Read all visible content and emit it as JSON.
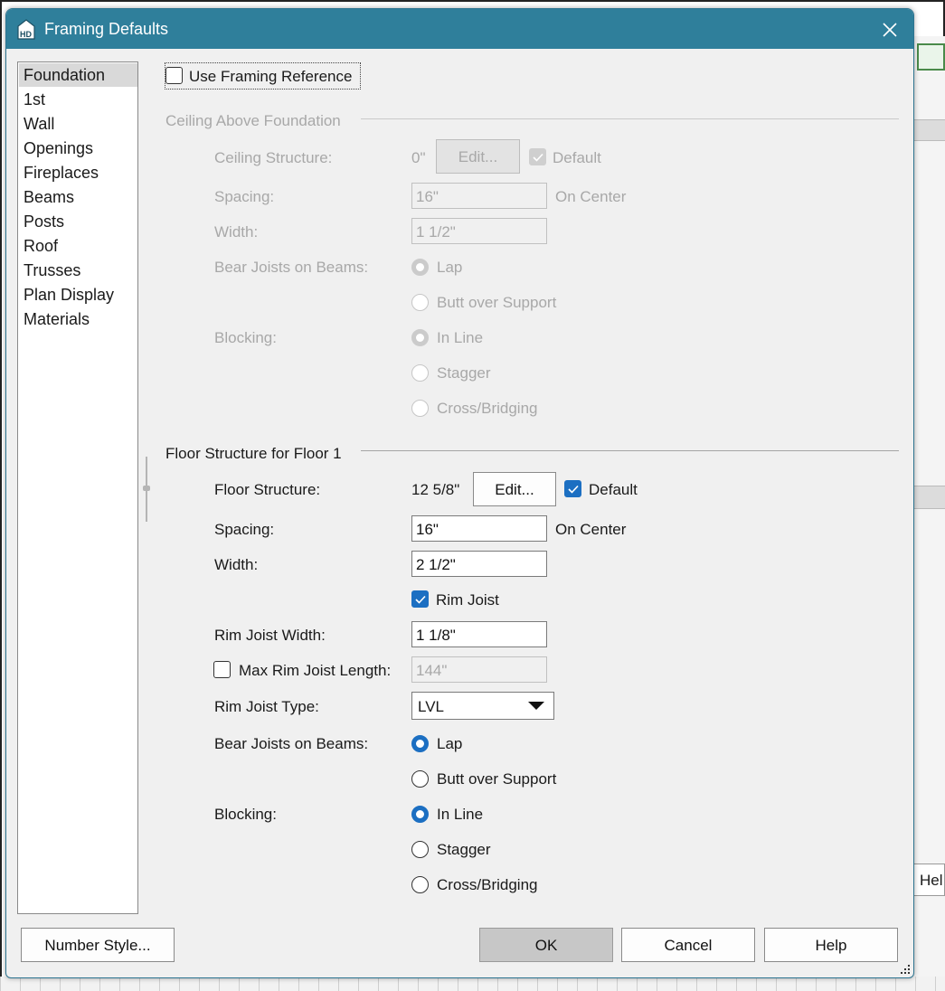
{
  "dialog": {
    "title": "Framing Defaults",
    "icon": "home-designer-icon"
  },
  "sidebar": {
    "items": [
      {
        "label": "Foundation",
        "selected": true
      },
      {
        "label": "1st"
      },
      {
        "label": "Wall"
      },
      {
        "label": "Openings"
      },
      {
        "label": "Fireplaces"
      },
      {
        "label": "Beams"
      },
      {
        "label": "Posts"
      },
      {
        "label": "Roof"
      },
      {
        "label": "Trusses"
      },
      {
        "label": "Plan Display"
      },
      {
        "label": "Materials"
      }
    ]
  },
  "use_framing_reference": {
    "label": "Use Framing Reference",
    "checked": false
  },
  "ceiling": {
    "group_title": "Ceiling Above Foundation",
    "structure_label": "Ceiling Structure:",
    "structure_value": "0\"",
    "edit_label": "Edit...",
    "default_label": "Default",
    "default_checked": true,
    "spacing_label": "Spacing:",
    "spacing_value": "16\"",
    "on_center": "On Center",
    "width_label": "Width:",
    "width_value": "1 1/2\"",
    "bear_label": "Bear Joists on Beams:",
    "bear_options": [
      "Lap",
      "Butt over Support"
    ],
    "bear_selected": "Lap",
    "blocking_label": "Blocking:",
    "blocking_options": [
      "In Line",
      "Stagger",
      "Cross/Bridging"
    ],
    "blocking_selected": "In Line",
    "enabled": false
  },
  "floor": {
    "group_title": "Floor Structure for Floor 1",
    "structure_label": "Floor Structure:",
    "structure_value": "12 5/8\"",
    "edit_label": "Edit...",
    "default_label": "Default",
    "default_checked": true,
    "spacing_label": "Spacing:",
    "spacing_value": "16\"",
    "on_center": "On Center",
    "width_label": "Width:",
    "width_value": "2 1/2\"",
    "rim_joist_label": "Rim Joist",
    "rim_joist_checked": true,
    "rim_width_label": "Rim Joist Width:",
    "rim_width_value": "1 1/8\"",
    "max_rim_label": "Max Rim Joist Length:",
    "max_rim_checked": false,
    "max_rim_value": "144\"",
    "rim_type_label": "Rim Joist Type:",
    "rim_type_value": "LVL",
    "bear_label": "Bear Joists on Beams:",
    "bear_options": [
      "Lap",
      "Butt over Support"
    ],
    "bear_selected": "Lap",
    "blocking_label": "Blocking:",
    "blocking_options": [
      "In Line",
      "Stagger",
      "Cross/Bridging"
    ],
    "blocking_selected": "In Line"
  },
  "footer": {
    "number_style": "Number Style...",
    "ok": "OK",
    "cancel": "Cancel",
    "help": "Help"
  },
  "background": {
    "help_fragment": "Hel"
  },
  "colors": {
    "titlebar": "#2f7f9b",
    "accent": "#1c6fc2",
    "dialog_bg": "#f0f0f0"
  }
}
